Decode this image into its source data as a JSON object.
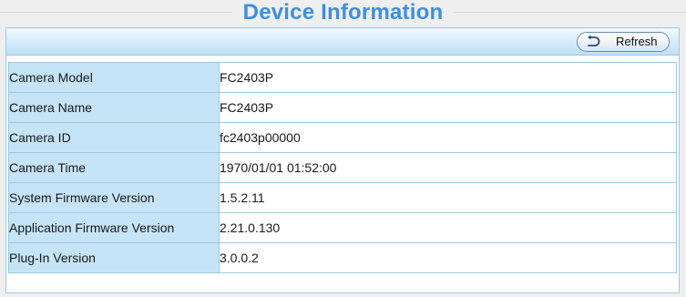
{
  "page": {
    "title": "Device Information"
  },
  "toolbar": {
    "refresh_label": "Refresh"
  },
  "colors": {
    "title": "#3d8fe0",
    "label_cell_bg": "#c6e4f8",
    "border": "#9cc9e3"
  },
  "icons": {
    "refresh": "refresh-arrow-icon"
  },
  "info": {
    "rows": [
      {
        "label": "Camera Model",
        "value": "FC2403P"
      },
      {
        "label": "Camera Name",
        "value": "FC2403P"
      },
      {
        "label": "Camera ID",
        "value": "fc2403p00000"
      },
      {
        "label": "Camera Time",
        "value": "1970/01/01 01:52:00"
      },
      {
        "label": "System Firmware Version",
        "value": "1.5.2.11"
      },
      {
        "label": "Application Firmware Version",
        "value": "2.21.0.130"
      },
      {
        "label": "Plug-In Version",
        "value": "3.0.0.2"
      }
    ]
  }
}
